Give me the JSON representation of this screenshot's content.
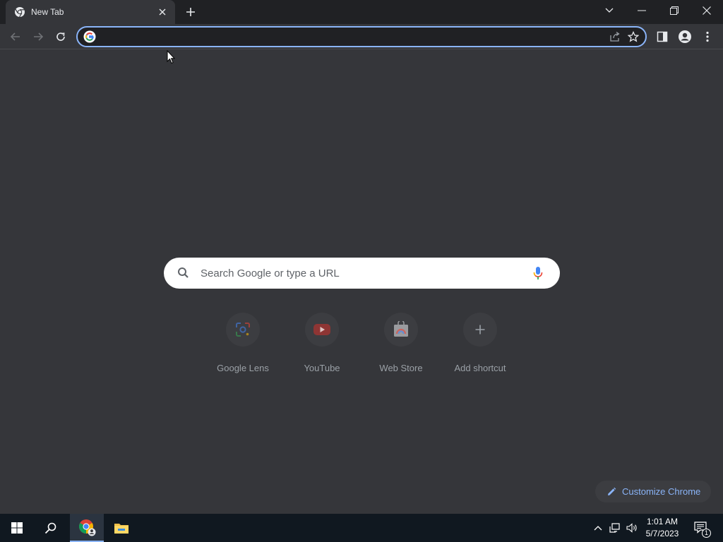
{
  "tab": {
    "title": "New Tab"
  },
  "omnibox": {
    "value": "",
    "placeholder": ""
  },
  "search": {
    "placeholder": "Search Google or type a URL"
  },
  "shortcuts": [
    {
      "label": "Google Lens",
      "icon": "google-lens-icon"
    },
    {
      "label": "YouTube",
      "icon": "youtube-icon"
    },
    {
      "label": "Web Store",
      "icon": "web-store-icon"
    },
    {
      "label": "Add shortcut",
      "icon": "plus-icon"
    }
  ],
  "customize": {
    "label": "Customize Chrome"
  },
  "taskbar": {
    "time": "1:01 AM",
    "date": "5/7/2023",
    "notification_count": "1"
  },
  "colors": {
    "accent": "#8ab4f8",
    "page_bg": "#35363a",
    "titlebar_bg": "#202124",
    "taskbar_bg": "#101820"
  }
}
